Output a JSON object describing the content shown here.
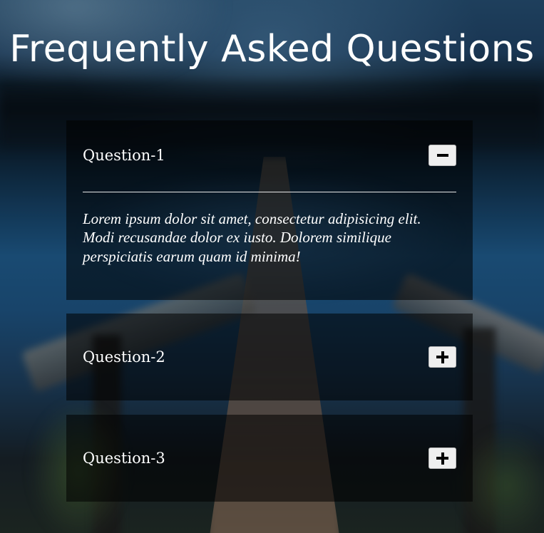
{
  "page": {
    "title": "Frequently Asked Questions"
  },
  "faq": {
    "items": [
      {
        "question": "Question-1",
        "answer": "Lorem ipsum dolor sit amet, consectetur adipisicing elit. Modi recusandae dolor ex iusto. Dolorem similique perspiciatis earum quam id minima!",
        "expanded": true,
        "toggle_icon": "minus-icon"
      },
      {
        "question": "Question-2",
        "expanded": false,
        "toggle_icon": "plus-icon"
      },
      {
        "question": "Question-3",
        "expanded": false,
        "toggle_icon": "plus-icon"
      }
    ]
  },
  "colors": {
    "text": "#ffffff",
    "panel": "rgba(0,0,0,0.55)",
    "button": "#efefef",
    "divider": "#e8e8e8"
  }
}
